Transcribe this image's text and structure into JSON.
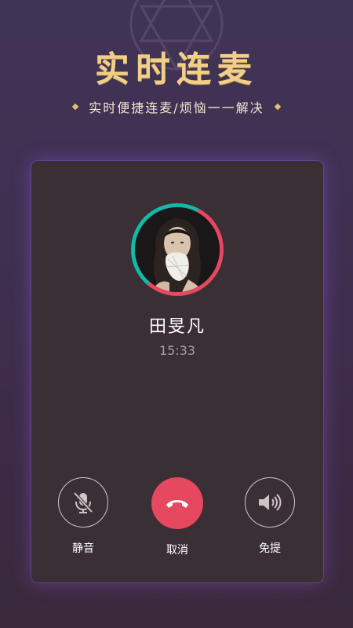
{
  "hero": {
    "title": "实时连麦",
    "subtitle": "实时便捷连麦/烦恼一一解决"
  },
  "call": {
    "contact_name": "田旻凡",
    "timer": "15:33"
  },
  "controls": {
    "mute_label": "静音",
    "hangup_label": "取消",
    "speaker_label": "免提"
  },
  "colors": {
    "accent_gold": "#f2cf86",
    "hangup_red": "#e6485f",
    "ring_teal": "#13b9a7",
    "card_bg": "#3a2f35"
  },
  "icons": {
    "mute": "microphone-muted-icon",
    "hangup": "phone-hangup-icon",
    "speaker": "speaker-icon",
    "decor": "diamond-icon"
  }
}
